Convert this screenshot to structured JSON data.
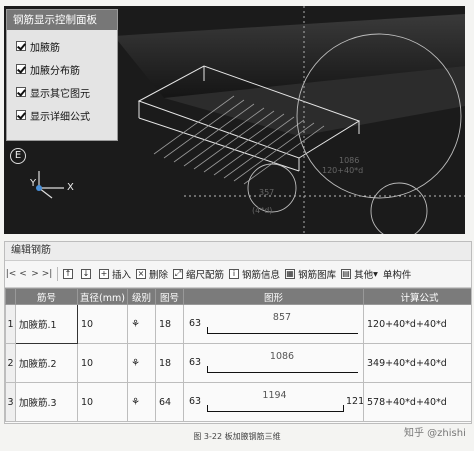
{
  "control_panel": {
    "title": "钢筋显示控制面板",
    "options": [
      {
        "label": "加腋筋",
        "checked": true
      },
      {
        "label": "加腋分布筋",
        "checked": true
      },
      {
        "label": "显示其它图元",
        "checked": true
      },
      {
        "label": "显示详细公式",
        "checked": true
      }
    ]
  },
  "viewport": {
    "marker": "E",
    "axis_y": "Y",
    "axis_x": "X",
    "dim_1": "357",
    "dim_2": "(4*d)",
    "label_1": "1086",
    "label_2": "120+40*d"
  },
  "editor": {
    "title": "编辑钢筋",
    "toolbar": {
      "insert": "插入",
      "delete": "删除",
      "scale": "缩尺配筋",
      "info": "钢筋信息",
      "library": "钢筋图库",
      "other": "其他",
      "unit": "单构件"
    },
    "columns": [
      "筋号",
      "直径(mm)",
      "级别",
      "图号",
      "图形",
      "计算公式"
    ],
    "rows": [
      {
        "index": "1",
        "name": "加腋筋.1",
        "diameter": "10",
        "grade": "⚘",
        "figure_no": "18",
        "left": "63",
        "length": "857",
        "right": "",
        "formula": "120+40*d+40*d"
      },
      {
        "index": "2",
        "name": "加腋筋.2",
        "diameter": "10",
        "grade": "⚘",
        "figure_no": "18",
        "left": "63",
        "length": "1086",
        "right": "",
        "formula": "349+40*d+40*d"
      },
      {
        "index": "3",
        "name": "加腋筋.3",
        "diameter": "10",
        "grade": "⚘",
        "figure_no": "64",
        "left": "63",
        "length": "1194",
        "right": "121",
        "formula": "578+40*d+40*d"
      }
    ]
  },
  "caption": "图 3-22    板加腋钢筋三维",
  "watermark": "知乎 @zhishi"
}
